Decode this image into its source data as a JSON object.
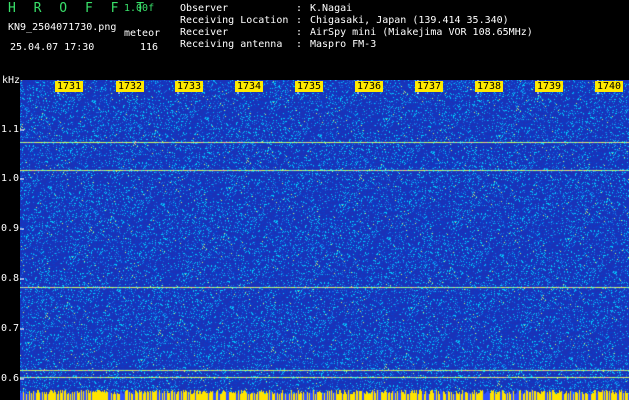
{
  "app": {
    "name": "H R O F F T",
    "version": "1.00f"
  },
  "file": {
    "name": "KN9_2504071730.png",
    "datetime": "25.04.07 17:30"
  },
  "meteor": {
    "label": "meteor",
    "count": "116"
  },
  "info": [
    {
      "label": "Observer",
      "value": "K.Nagai"
    },
    {
      "label": "Receiving Location",
      "value": "Chigasaki, Japan (139.414 35.340)"
    },
    {
      "label": "Receiver",
      "value": "AirSpy mini (Miakejima VOR 108.65MHz)"
    },
    {
      "label": "Receiving antenna",
      "value": "Maspro FM-3"
    }
  ],
  "colon": ":",
  "spectrogram": {
    "y_unit": "kHz",
    "y_ticks": [
      "1.1",
      "1.0",
      "0.9",
      "0.8",
      "0.7",
      "0.6"
    ],
    "x_ticks": [
      "1731",
      "1732",
      "1733",
      "1734",
      "1735",
      "1736",
      "1737",
      "1738",
      "1739",
      "1740"
    ],
    "colors": {
      "background": "#1a32b8",
      "noise_hi": "#00d8ff",
      "line": "#d0ff60",
      "bottom_bar": "#ffe400"
    }
  }
}
